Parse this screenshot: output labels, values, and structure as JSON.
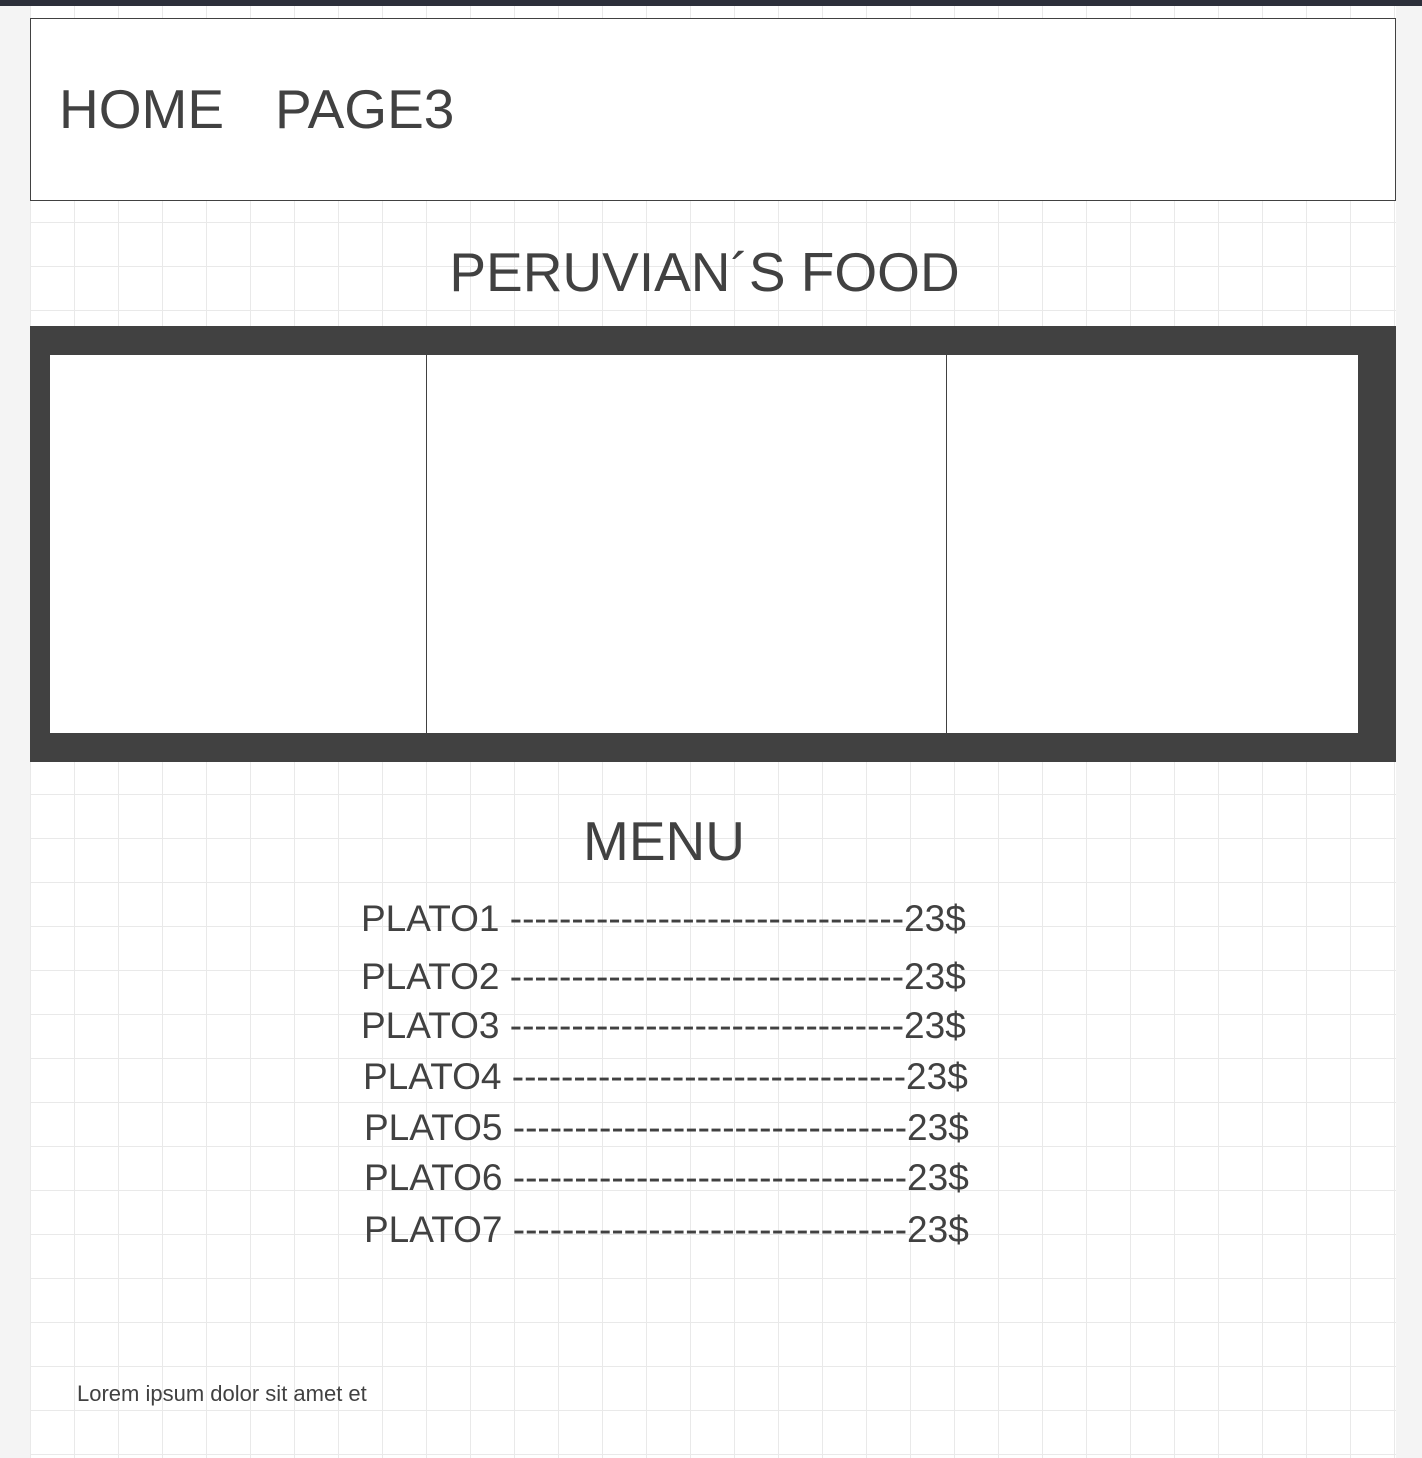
{
  "nav": {
    "home_label": "HOME",
    "page3_label": "PAGE3"
  },
  "title": "PERUVIAN´S FOOD",
  "menu": {
    "title": "MENU",
    "items": [
      "PLATO1 --------------------------------23$",
      "PLATO2 --------------------------------23$",
      "PLATO3 --------------------------------23$",
      "PLATO4 --------------------------------23$",
      "PLATO5 --------------------------------23$",
      "PLATO6 --------------------------------23$",
      "PLATO7 --------------------------------23$"
    ]
  },
  "footer": {
    "text": "Lorem ipsum dolor sit amet et"
  },
  "colors": {
    "text": "#414141",
    "carousel_frame": "#414141",
    "topbar": "#2c2f3a",
    "grid_line": "#e9e9e9"
  }
}
